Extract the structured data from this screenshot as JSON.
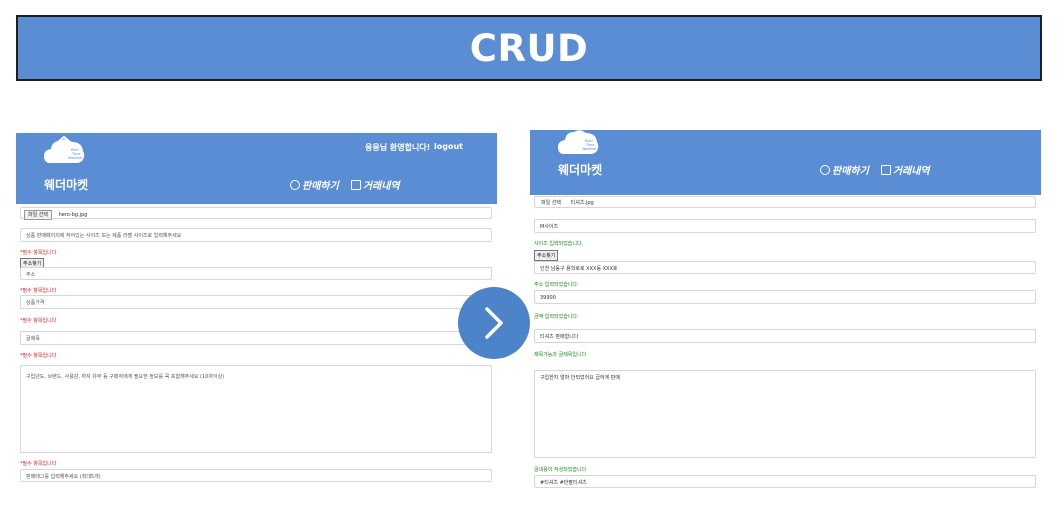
{
  "banner": {
    "title": "CRUD"
  },
  "left": {
    "logo_text": "Real\nTime\nWeather",
    "brand": "웨더마켓",
    "welcome": "응응님 환영합니다!",
    "logout": "logout",
    "nav": {
      "sell": "판매하기",
      "history": "거래내역"
    },
    "file_label": "파일 선택",
    "file_name": "hero-bg.jpg",
    "size_placeholder": "상품 판매페이지에 작어있는 사이즈 또는 제품 라벨 사이즈로 입력해주세요",
    "required_msg": "*필수 항목입니다",
    "address_button": "주소찾기",
    "address_placeholder": "주소",
    "price_placeholder": "상품가격",
    "title_placeholder": "글제목",
    "desc_placeholder": "구입년도, 브랜드, 사용감, 하자 유무 등 구매자에게 필요한 정보를 꼭 포함해주세요 (10자이상)",
    "tag_placeholder": "판매태그를 입력해주세요 (최대5개)"
  },
  "right": {
    "logo_text": "Real\nTime\nWeather",
    "brand": "웨더마켓",
    "nav": {
      "sell": "판매하기",
      "history": "거래내역"
    },
    "file_label": "파일 선택",
    "file_name": "티셔츠.jpg",
    "size_value": "M사이즈",
    "size_ok": "사이즈 입력되었습니다.",
    "address_button": "주소찾기",
    "address_value": "인천 남동구 용학로로 XXX동 XXX호",
    "address_ok": "주소 입력되었습니다.",
    "price_value": "39900",
    "price_ok": "금액 입력되었습니다.",
    "title_value": "티셔츠 판매합니다",
    "title_ok": "제목가능과 글제목입니다",
    "desc_value": "구입한지 얼마 안되었어요 급하게 판매",
    "desc_ok": "글내용이 작성되었습니다",
    "tag_value": "#티셔츠 #반팔티셔츠"
  },
  "colors": {
    "header": "#5a8dd3",
    "next_button": "#4c83c9",
    "error": "#e02020",
    "success": "#1b8a1b"
  }
}
